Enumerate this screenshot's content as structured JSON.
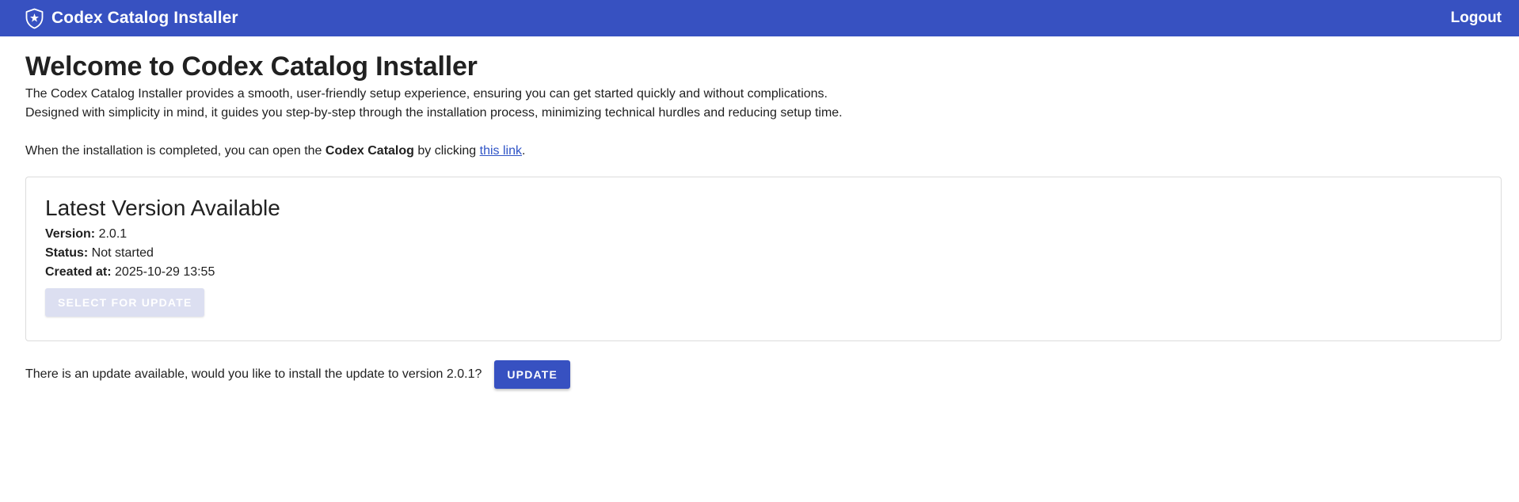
{
  "header": {
    "title": "Codex Catalog Installer",
    "logo_icon": "shield-star-icon",
    "logout_label": "Logout",
    "background_color": "#3751c1"
  },
  "main": {
    "title": "Welcome to Codex Catalog Installer",
    "intro_line1": "The Codex Catalog Installer provides a smooth, user-friendly setup experience, ensuring you can get started quickly and without complications.",
    "intro_line2": "Designed with simplicity in mind, it guides you step-by-step through the installation process, minimizing technical hurdles and reducing setup time.",
    "completion_prefix": "When the installation is completed, you can open the ",
    "completion_bold": "Codex Catalog",
    "completion_middle": " by clicking ",
    "completion_link": "this link",
    "completion_suffix": "."
  },
  "version_card": {
    "title": "Latest Version Available",
    "version_label": "Version:",
    "version_value": " 2.0.1",
    "status_label": "Status:",
    "status_value": " Not started",
    "created_label": "Created at:",
    "created_value": " 2025-10-29 13:55",
    "select_button_label": "Select for update"
  },
  "update_prompt": {
    "text": "There is an update available, would you like to install the update to version 2.0.1?",
    "button_label": "Update"
  }
}
